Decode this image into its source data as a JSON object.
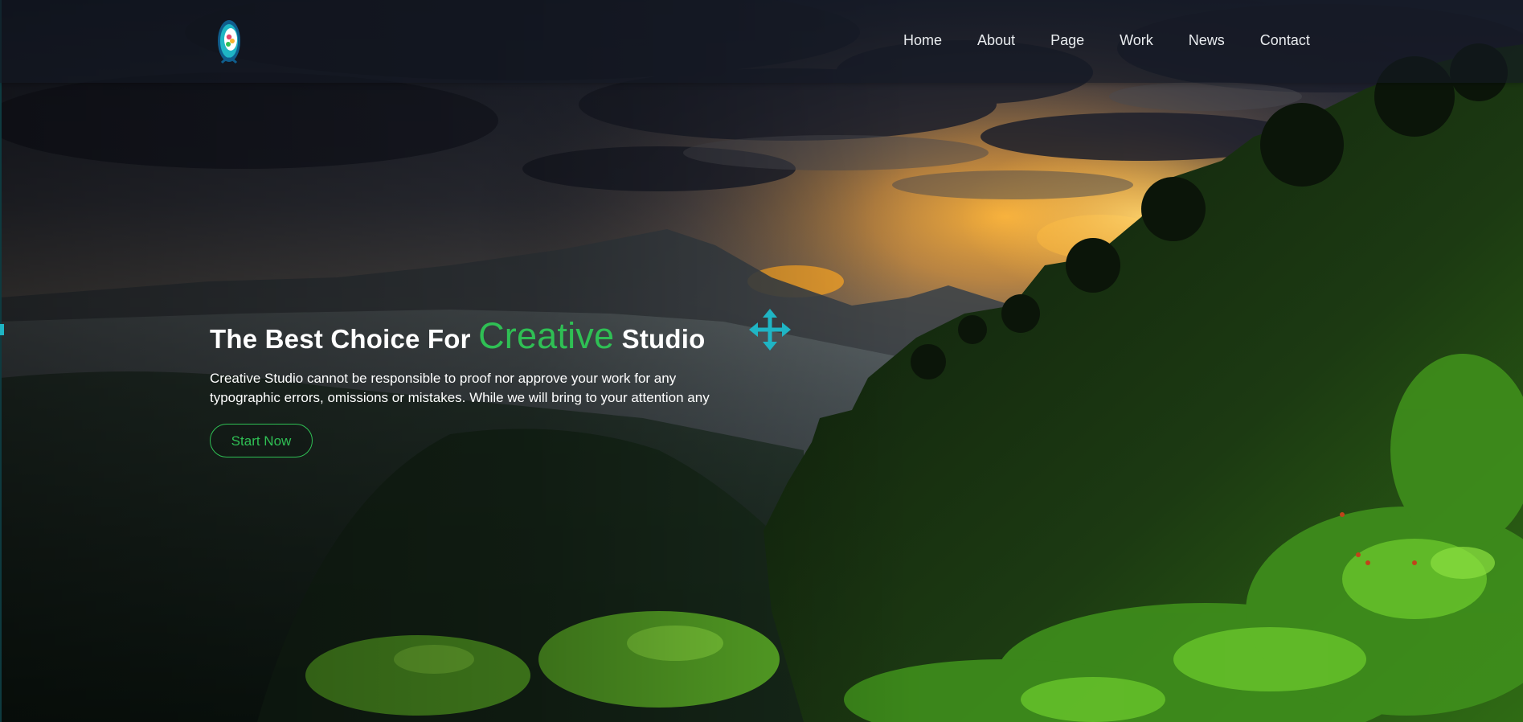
{
  "header": {
    "logo_icon": "circular-emblem-logo-icon",
    "nav": [
      {
        "label": "Home"
      },
      {
        "label": "About"
      },
      {
        "label": "Page"
      },
      {
        "label": "Work"
      },
      {
        "label": "News"
      },
      {
        "label": "Contact"
      }
    ]
  },
  "hero": {
    "headline_before": "The Best Choice For",
    "headline_accent": "Creative",
    "headline_after": "Studio",
    "description": "Creative Studio cannot be responsible to proof nor approve your work for any typographic errors, omissions or mistakes. While we will bring to your attention any",
    "cta_label": "Start Now",
    "move_icon": "move-arrows-icon"
  },
  "colors": {
    "accent": "#2fbf54",
    "move_icon": "#1fb5c4",
    "nav_text": "#e9ecef",
    "header_bg": "#141824"
  }
}
